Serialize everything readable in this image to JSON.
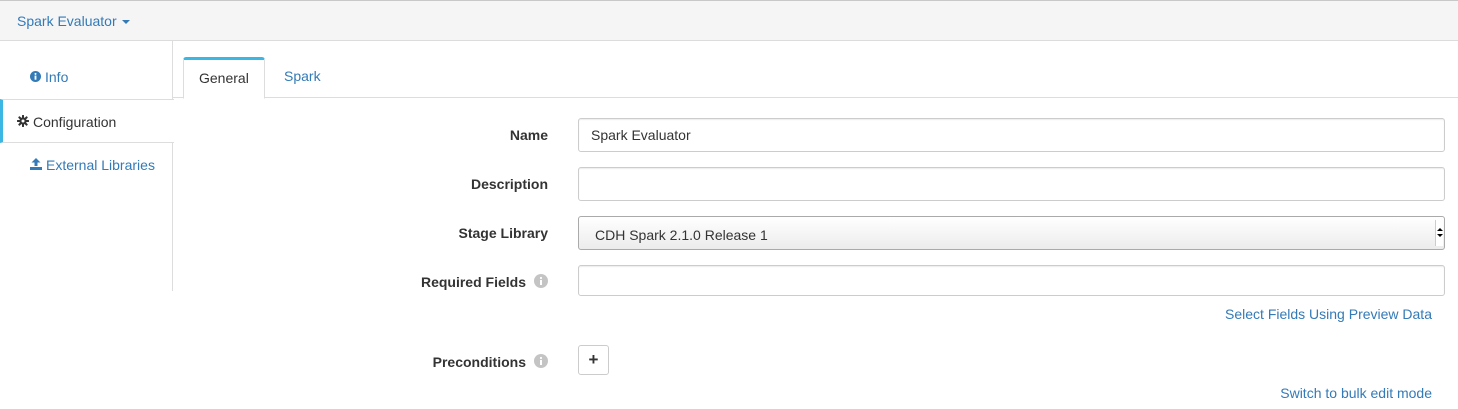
{
  "header": {
    "stage_title": "Spark Evaluator"
  },
  "sidebar": {
    "items": [
      {
        "label": "Info",
        "icon": "info-circle-icon"
      },
      {
        "label": "Configuration",
        "icon": "gear-icon",
        "active": true
      },
      {
        "label": "External Libraries",
        "icon": "upload-icon"
      }
    ]
  },
  "tabs": [
    {
      "label": "General",
      "active": true
    },
    {
      "label": "Spark"
    }
  ],
  "form": {
    "name_label": "Name",
    "name_value": "Spark Evaluator",
    "description_label": "Description",
    "description_value": "",
    "stage_library_label": "Stage Library",
    "stage_library_value": "CDH Spark 2.1.0 Release 1",
    "required_fields_label": "Required Fields",
    "required_fields_value": "",
    "select_fields_link": "Select Fields Using Preview Data",
    "preconditions_label": "Preconditions",
    "add_button_label": "+",
    "bulk_edit_link": "Switch to bulk edit mode"
  },
  "colors": {
    "link": "#337ab7",
    "active_accent": "#3cb6e3",
    "header_bg": "#f5f5f5"
  }
}
